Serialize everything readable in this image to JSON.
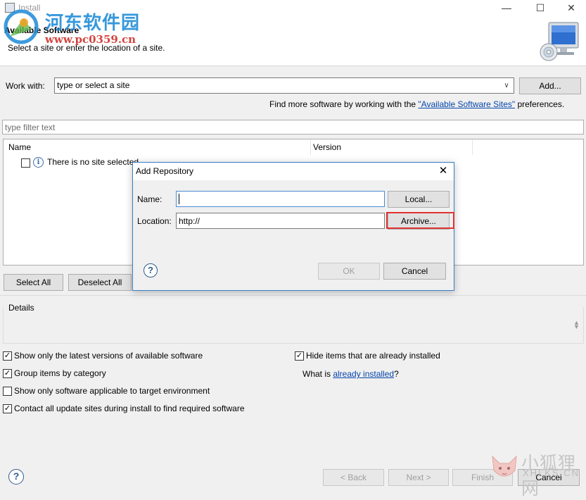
{
  "window": {
    "title": "Install"
  },
  "header": {
    "title": "Available Software",
    "description": "Select a site or enter the location of a site."
  },
  "watermark_top": {
    "title": "河东软件园",
    "url": "www.pc0359.cn"
  },
  "work_with": {
    "label": "Work with:",
    "value": "type or select a site",
    "add_label": "Add..."
  },
  "find_more": {
    "prefix": "Find more software by working with the ",
    "link": "\"Available Software Sites\"",
    "suffix": " preferences."
  },
  "filter": {
    "placeholder": "type filter text"
  },
  "tree": {
    "columns": [
      "Name",
      "Version"
    ],
    "items": [
      {
        "label": "There is no site selected.",
        "checked": false
      }
    ]
  },
  "selection": {
    "select_all": "Select All",
    "deselect_all": "Deselect All"
  },
  "details": {
    "label": "Details"
  },
  "options_left": [
    {
      "label": "Show only the latest versions of available software",
      "checked": true
    },
    {
      "label": "Group items by category",
      "checked": true
    },
    {
      "label": "Show only software applicable to target environment",
      "checked": false
    },
    {
      "label": "Contact all update sites during install to find required software",
      "checked": true
    }
  ],
  "options_right": [
    {
      "label": "Hide items that are already installed",
      "checked": true
    }
  ],
  "what_is": {
    "prefix": "What is ",
    "link": "already installed",
    "suffix": "?"
  },
  "footer": {
    "help": "?",
    "back": "< Back",
    "next": "Next >",
    "finish": "Finish",
    "cancel": "Cancel"
  },
  "watermark_bottom": {
    "cn": "小狐狸网",
    "en": "XHLKS.CN"
  },
  "dialog": {
    "title": "Add Repository",
    "close": "✕",
    "name_label": "Name:",
    "name_value": "",
    "local_label": "Local...",
    "location_label": "Location:",
    "location_value": "http://",
    "archive_label": "Archive...",
    "help": "?",
    "ok_label": "OK",
    "cancel_label": "Cancel",
    "highlight_color": "#e03232"
  }
}
